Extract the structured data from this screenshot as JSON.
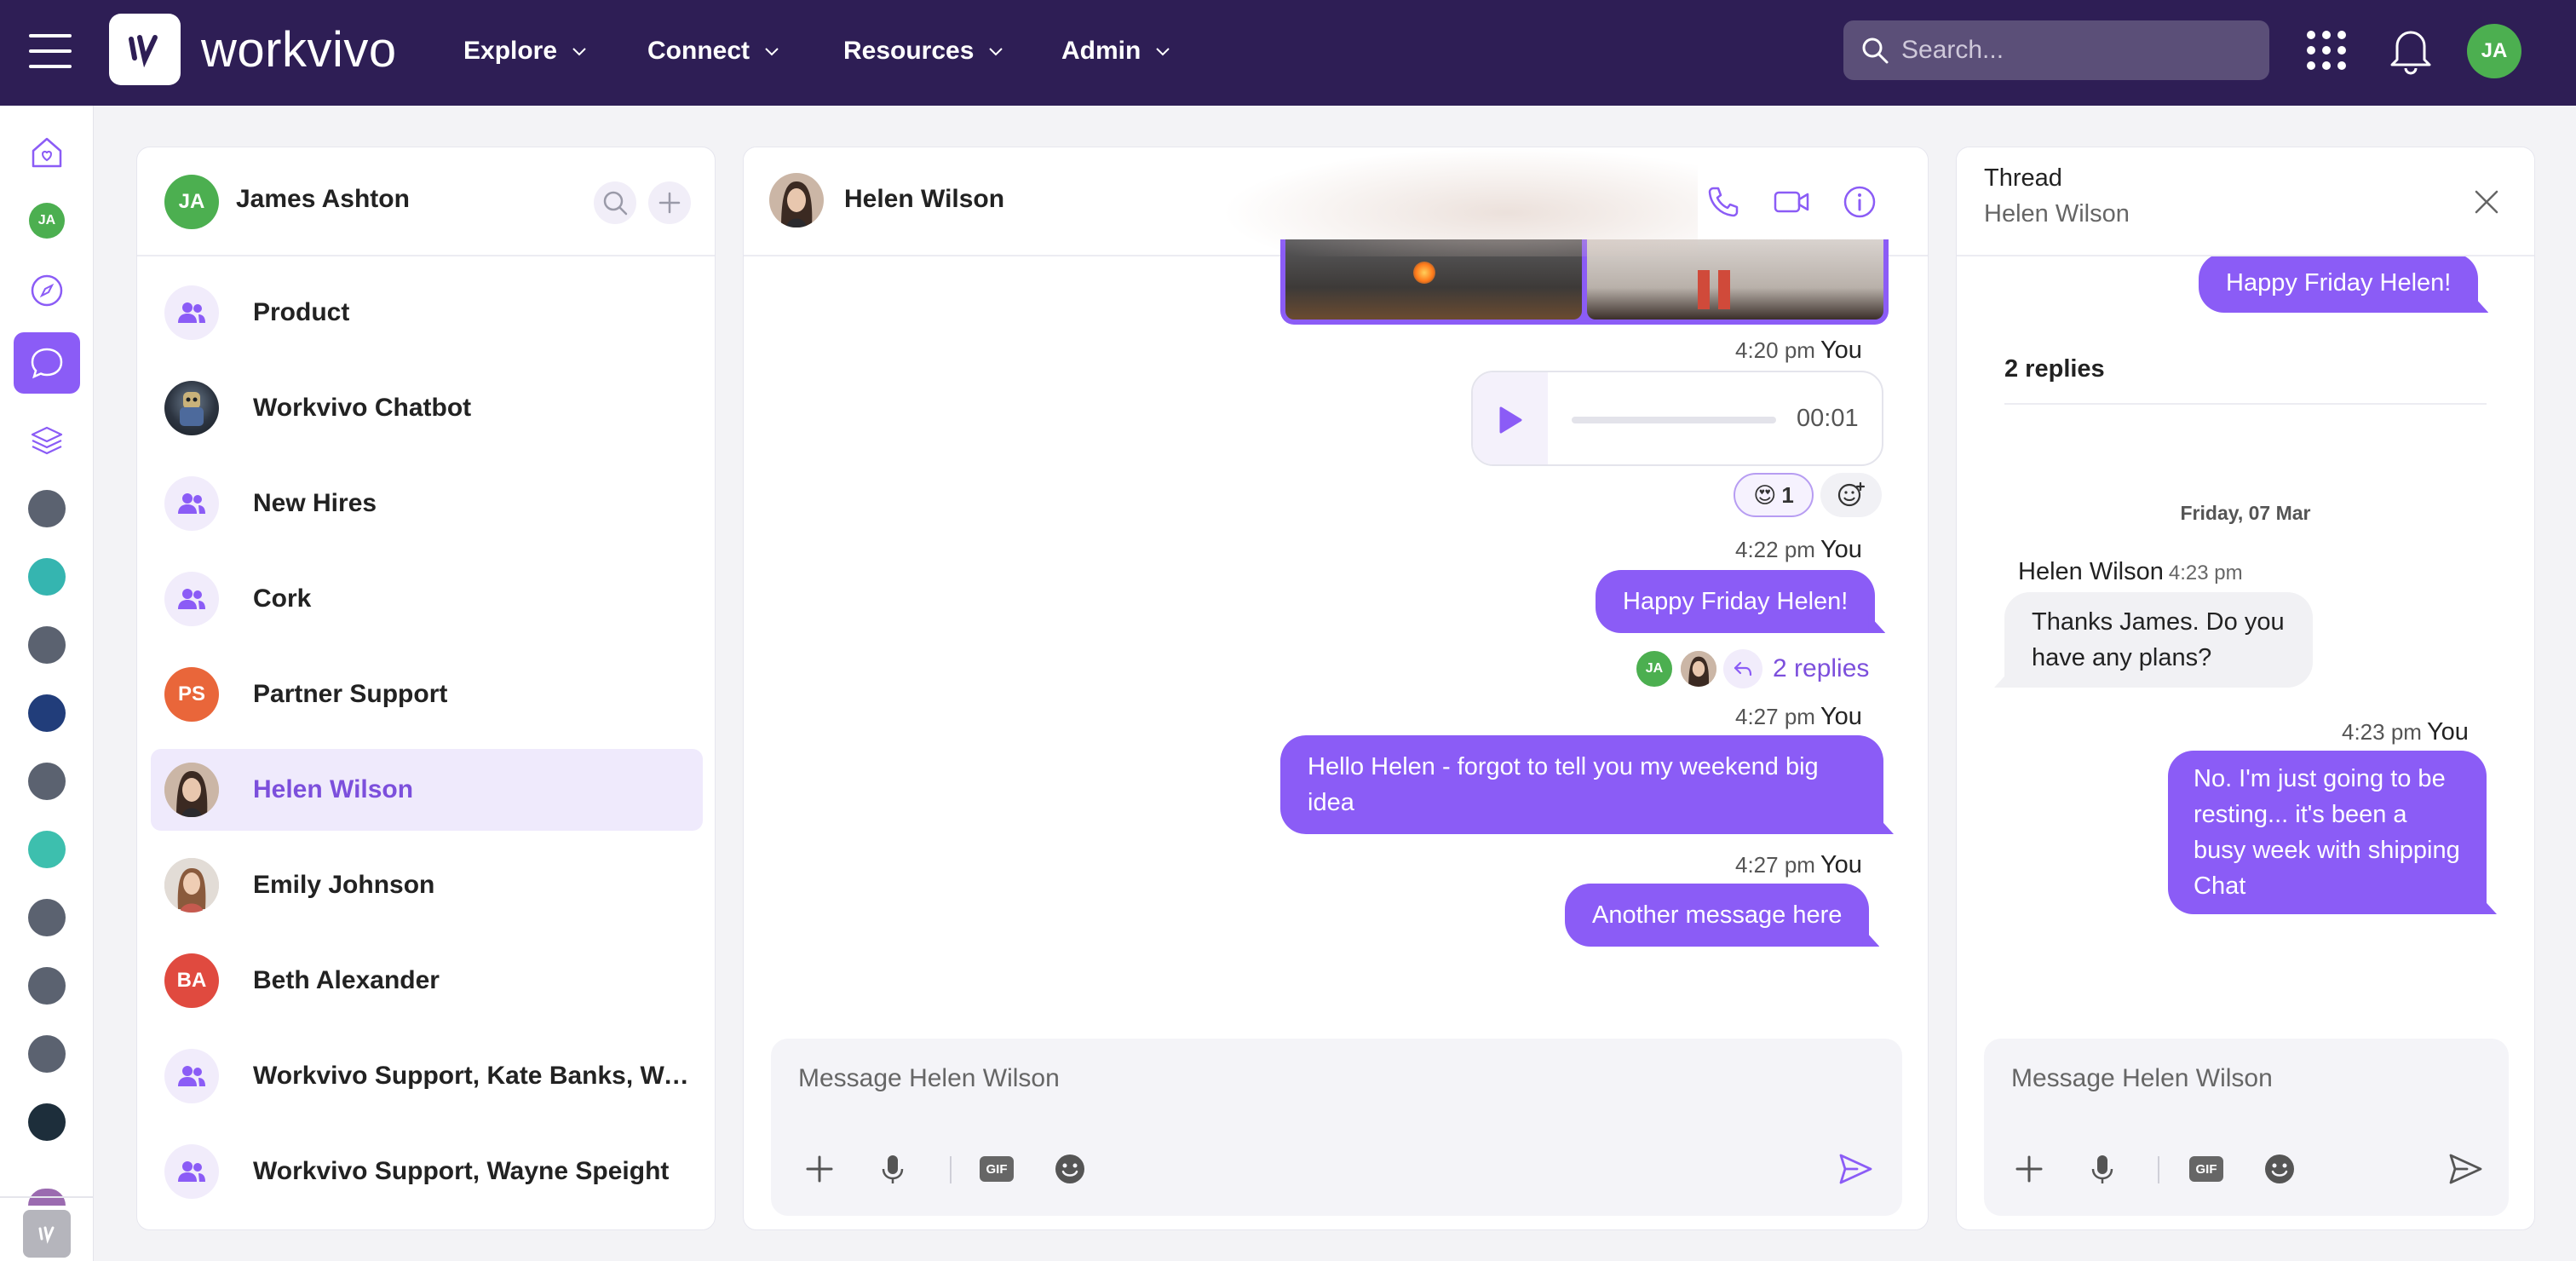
{
  "topbar": {
    "brand": "workvivo",
    "nav": [
      "Explore",
      "Connect",
      "Resources",
      "Admin"
    ],
    "search_placeholder": "Search...",
    "user_initials": "JA"
  },
  "rail": {
    "user_initials": "JA"
  },
  "conversations": {
    "me": {
      "name": "James Ashton",
      "initials": "JA"
    },
    "items": [
      {
        "name": "Product",
        "type": "group"
      },
      {
        "name": "Workvivo Chatbot",
        "type": "photo"
      },
      {
        "name": "New Hires",
        "type": "group"
      },
      {
        "name": "Cork",
        "type": "group"
      },
      {
        "name": "Partner Support",
        "type": "initials",
        "initials": "PS",
        "color": "#e9663a"
      },
      {
        "name": "Helen Wilson",
        "type": "photo",
        "active": true
      },
      {
        "name": "Emily Johnson",
        "type": "photo"
      },
      {
        "name": "Beth Alexander",
        "type": "initials",
        "initials": "BA",
        "color": "#e04a3f"
      },
      {
        "name": "Workvivo Support, Kate Banks, Wayne Speight",
        "type": "group"
      },
      {
        "name": "Workvivo Support, Wayne Speight",
        "type": "group"
      }
    ]
  },
  "chat": {
    "contact": "Helen Wilson",
    "messages": [
      {
        "time": "4:20 pm",
        "sender": "You",
        "kind": "audio",
        "duration": "00:01",
        "reaction_emoji": "😍",
        "reaction_count": "1"
      },
      {
        "time": "4:22 pm",
        "sender": "You",
        "text": "Happy Friday Helen!",
        "reply_initials": "JA",
        "replies": "2 replies"
      },
      {
        "time": "4:27 pm",
        "sender": "You",
        "text": "Hello Helen - forgot to tell you my weekend big idea"
      },
      {
        "time": "4:27 pm",
        "sender": "You",
        "text": "Another message here"
      }
    ],
    "composer_placeholder": "Message Helen Wilson",
    "gif_label": "GIF"
  },
  "thread": {
    "title": "Thread",
    "subtitle": "Helen Wilson",
    "root_text": "Happy Friday Helen!",
    "replies_count": "2 replies",
    "date": "Friday, 07 Mar",
    "incoming": {
      "sender": "Helen Wilson",
      "time": "4:23 pm",
      "text": "Thanks James. Do you have any plans?"
    },
    "outgoing": {
      "sender": "You",
      "time": "4:23 pm",
      "text": "No. I'm just going to be resting... it's been a busy week with shipping Chat"
    },
    "composer_placeholder": "Message Helen Wilson",
    "gif_label": "GIF"
  },
  "colors": {
    "topbar": "#2e1e55",
    "accent": "#8b5cf6",
    "accent_text": "#7c4fdc"
  }
}
